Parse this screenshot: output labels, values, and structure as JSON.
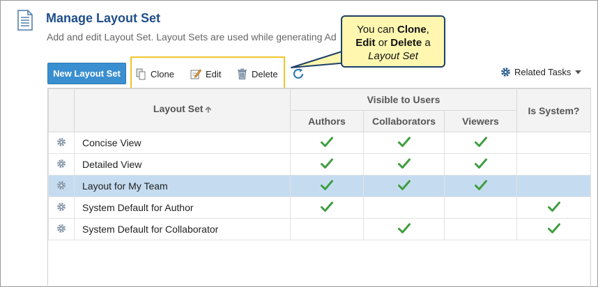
{
  "page": {
    "title": "Manage Layout Set",
    "subtitle": "Add and edit Layout Set. Layout Sets are used while generating Ad"
  },
  "toolbar": {
    "new_label": "New Layout Set",
    "clone_label": "Clone",
    "edit_label": "Edit",
    "delete_label": "Delete",
    "related_label": "Related Tasks"
  },
  "callout": {
    "line1_pre": "You can ",
    "line1_bold": "Clone",
    "line1_post": ",",
    "line2_bold1": "Edit",
    "line2_mid": " or ",
    "line2_bold2": "Delete",
    "line2_post": " a",
    "line3_italic": "Layout Set"
  },
  "table": {
    "col_layout_set": "Layout Set",
    "group_visible": "Visible to Users",
    "col_authors": "Authors",
    "col_collaborators": "Collaborators",
    "col_viewers": "Viewers",
    "col_is_system": "Is System?",
    "rows": [
      {
        "name": "Concise View",
        "authors": true,
        "collaborators": true,
        "viewers": true,
        "system": false,
        "selected": false
      },
      {
        "name": "Detailed View",
        "authors": true,
        "collaborators": true,
        "viewers": true,
        "system": false,
        "selected": false
      },
      {
        "name": "Layout for My Team",
        "authors": true,
        "collaborators": true,
        "viewers": true,
        "system": false,
        "selected": true
      },
      {
        "name": "System Default for Author",
        "authors": true,
        "collaborators": false,
        "viewers": false,
        "system": true,
        "selected": false
      },
      {
        "name": "System Default for Collaborator",
        "authors": false,
        "collaborators": true,
        "viewers": false,
        "system": true,
        "selected": false
      }
    ]
  },
  "colors": {
    "accent": "#3a8fd0",
    "title": "#1f4e8c",
    "highlight_box": "#f0c52a",
    "callout_bg": "#fff7b0",
    "selected_row": "#c5dcf0",
    "check": "#4caf50"
  },
  "icons": [
    "document-icon",
    "clone-icon",
    "edit-icon",
    "trash-icon",
    "refresh-icon",
    "gear-icon",
    "chevron-down-icon",
    "sort-up-icon",
    "check-icon"
  ]
}
